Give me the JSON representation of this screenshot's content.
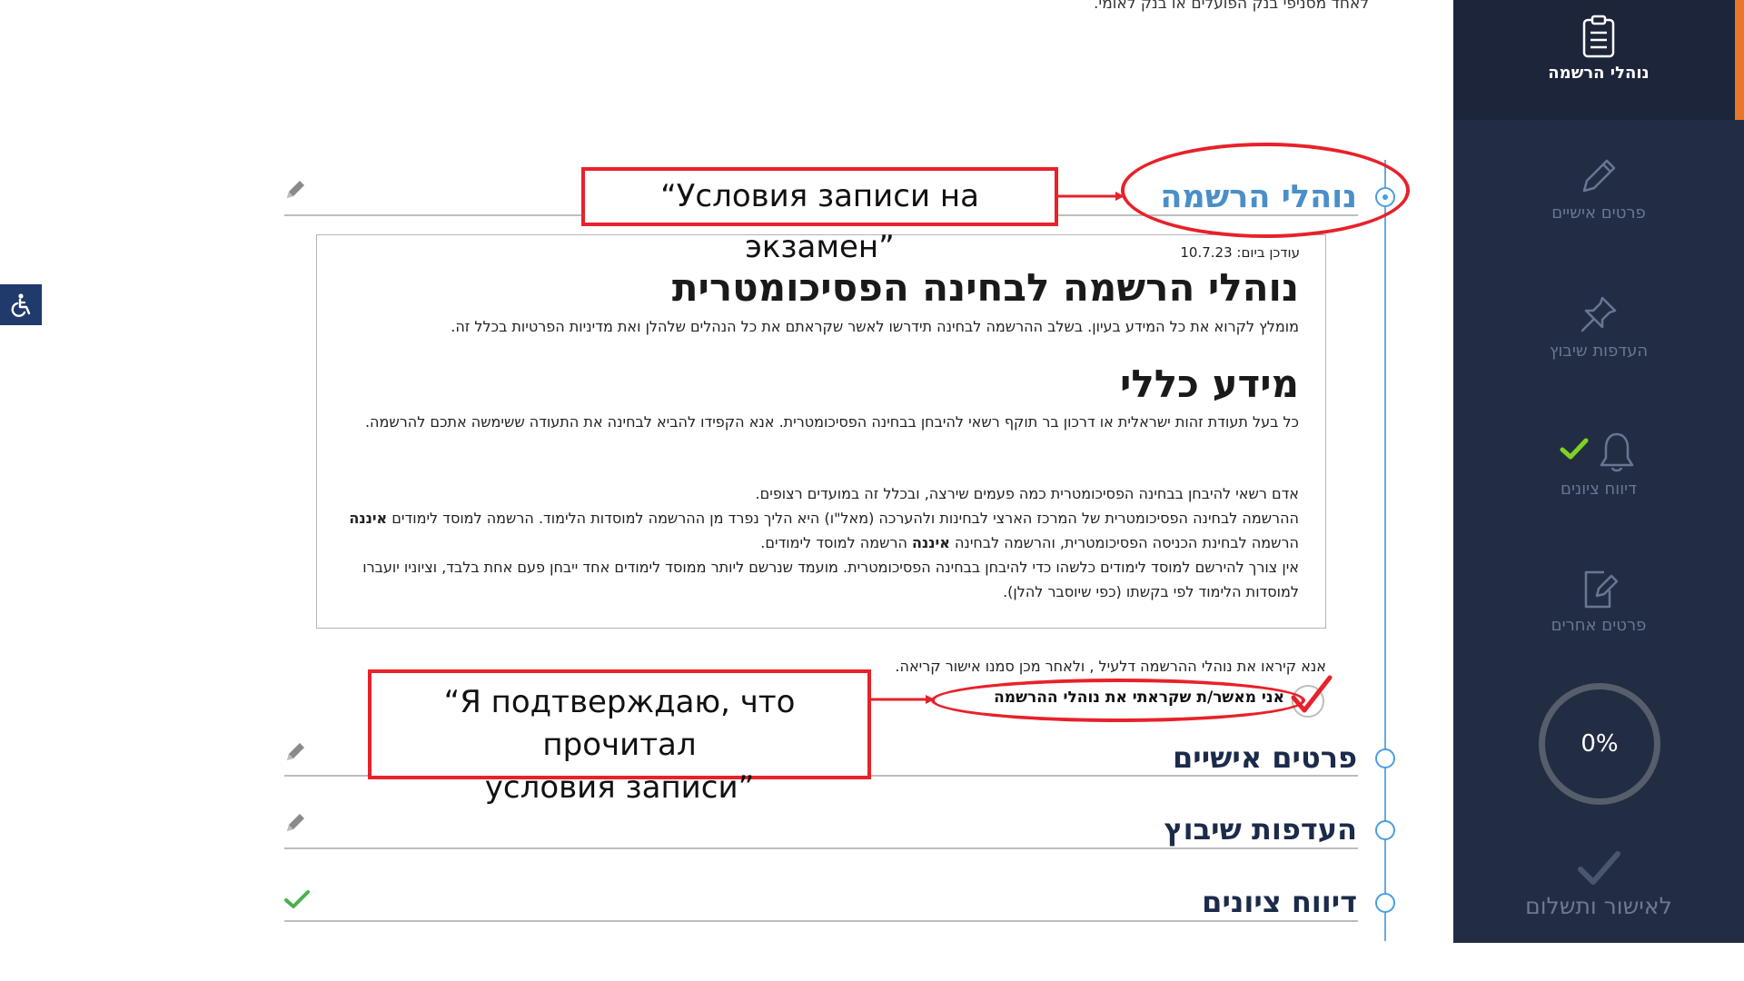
{
  "page": {
    "top_cut_text": "לאחד מסניפי בנק הפועלים או בנק לאומי.",
    "accessibility_icon": "wheelchair-icon"
  },
  "sections": [
    {
      "title": "נוהלי הרשמה",
      "state": "open",
      "icon": "pencil-icon"
    },
    {
      "title": "פרטים אישיים",
      "state": "closed",
      "icon": "pencil-icon"
    },
    {
      "title": "העדפות שיבוץ",
      "state": "closed",
      "icon": "pencil-icon"
    },
    {
      "title": "דיווח ציונים",
      "state": "done",
      "icon": "check-icon"
    }
  ],
  "content": {
    "updated": "עודכן ביום: 10.7.23",
    "main_title": "נוהלי הרשמה לבחינה הפסיכומטרית",
    "intro": "מומלץ לקרוא את כל המידע בעיון. בשלב ההרשמה לבחינה תידרשו לאשר שקראתם את כל הנהלים שלהלן ואת מדיניות הפרטיות בכלל זה.",
    "general_title": "מידע כללי",
    "general_text": "כל בעל תעודת זהות ישראלית או דרכון בר תוקף רשאי להיבחן בבחינה הפסיכומטרית. אנא הקפידו להביא לבחינה את התעודה ששימשה אתכם להרשמה.",
    "para1": "אדם רשאי להיבחן בבחינה הפסיכומטרית כמה פעמים שירצה, ובכלל זה במועדים רצופים.",
    "para2_a": "ההרשמה לבחינה הפסיכומטרית של המרכז הארצי לבחינות ולהערכה (מאל\"ו) היא הליך נפרד מן ההרשמה למוסדות הלימוד. הרשמה למוסד לימודים ",
    "para2_bold": "איננה",
    "para3_a": "הרשמה לבחינת הכניסה הפסיכומטרית, והרשמה לבחינה ",
    "para3_bold": "איננה",
    "para3_b": " הרשמה למוסד לימודים.",
    "para4": "אין צורך להירשם למוסד לימודים כלשהו כדי להיבחן בבחינה הפסיכומטרית. מועמד שנרשם ליותר ממוסד לימודים אחד ייבחן פעם אחת בלבד, וציוניו יועברו",
    "para5": "למוסדות הלימוד לפי בקשתו (כפי שיוסבר להלן)."
  },
  "confirm": {
    "instruction": "אנא קיראו את נוהלי ההרשמה דלעיל , ולאחר מכן סמנו אישור קריאה.",
    "label": "אני מאשר/ת שקראתי את נוהלי ההרשמה",
    "checked": true
  },
  "annotations": {
    "box1": "“Условия записи на экзамен”",
    "box2_line1": "“Я подтверждаю, что прочитал",
    "box2_line2": "условия записи”",
    "color": "#e8212a"
  },
  "sidebar": {
    "items": [
      {
        "label": "נוהלי הרשמה",
        "icon": "clipboard-icon",
        "active": true
      },
      {
        "label": "פרטים אישיים",
        "icon": "pencil-icon",
        "active": false
      },
      {
        "label": "העדפות שיבוץ",
        "icon": "pin-icon",
        "active": false
      },
      {
        "label": "דיווח ציונים",
        "icon": "bell-icon",
        "active": false,
        "completed": true
      },
      {
        "label": "פרטים אחרים",
        "icon": "edit-document-icon",
        "active": false
      }
    ],
    "progress": "0%",
    "submit_label": "לאישור ותשלום",
    "colors": {
      "background": "#222d44",
      "accent": "#e8762c",
      "check": "#7ed321"
    }
  }
}
